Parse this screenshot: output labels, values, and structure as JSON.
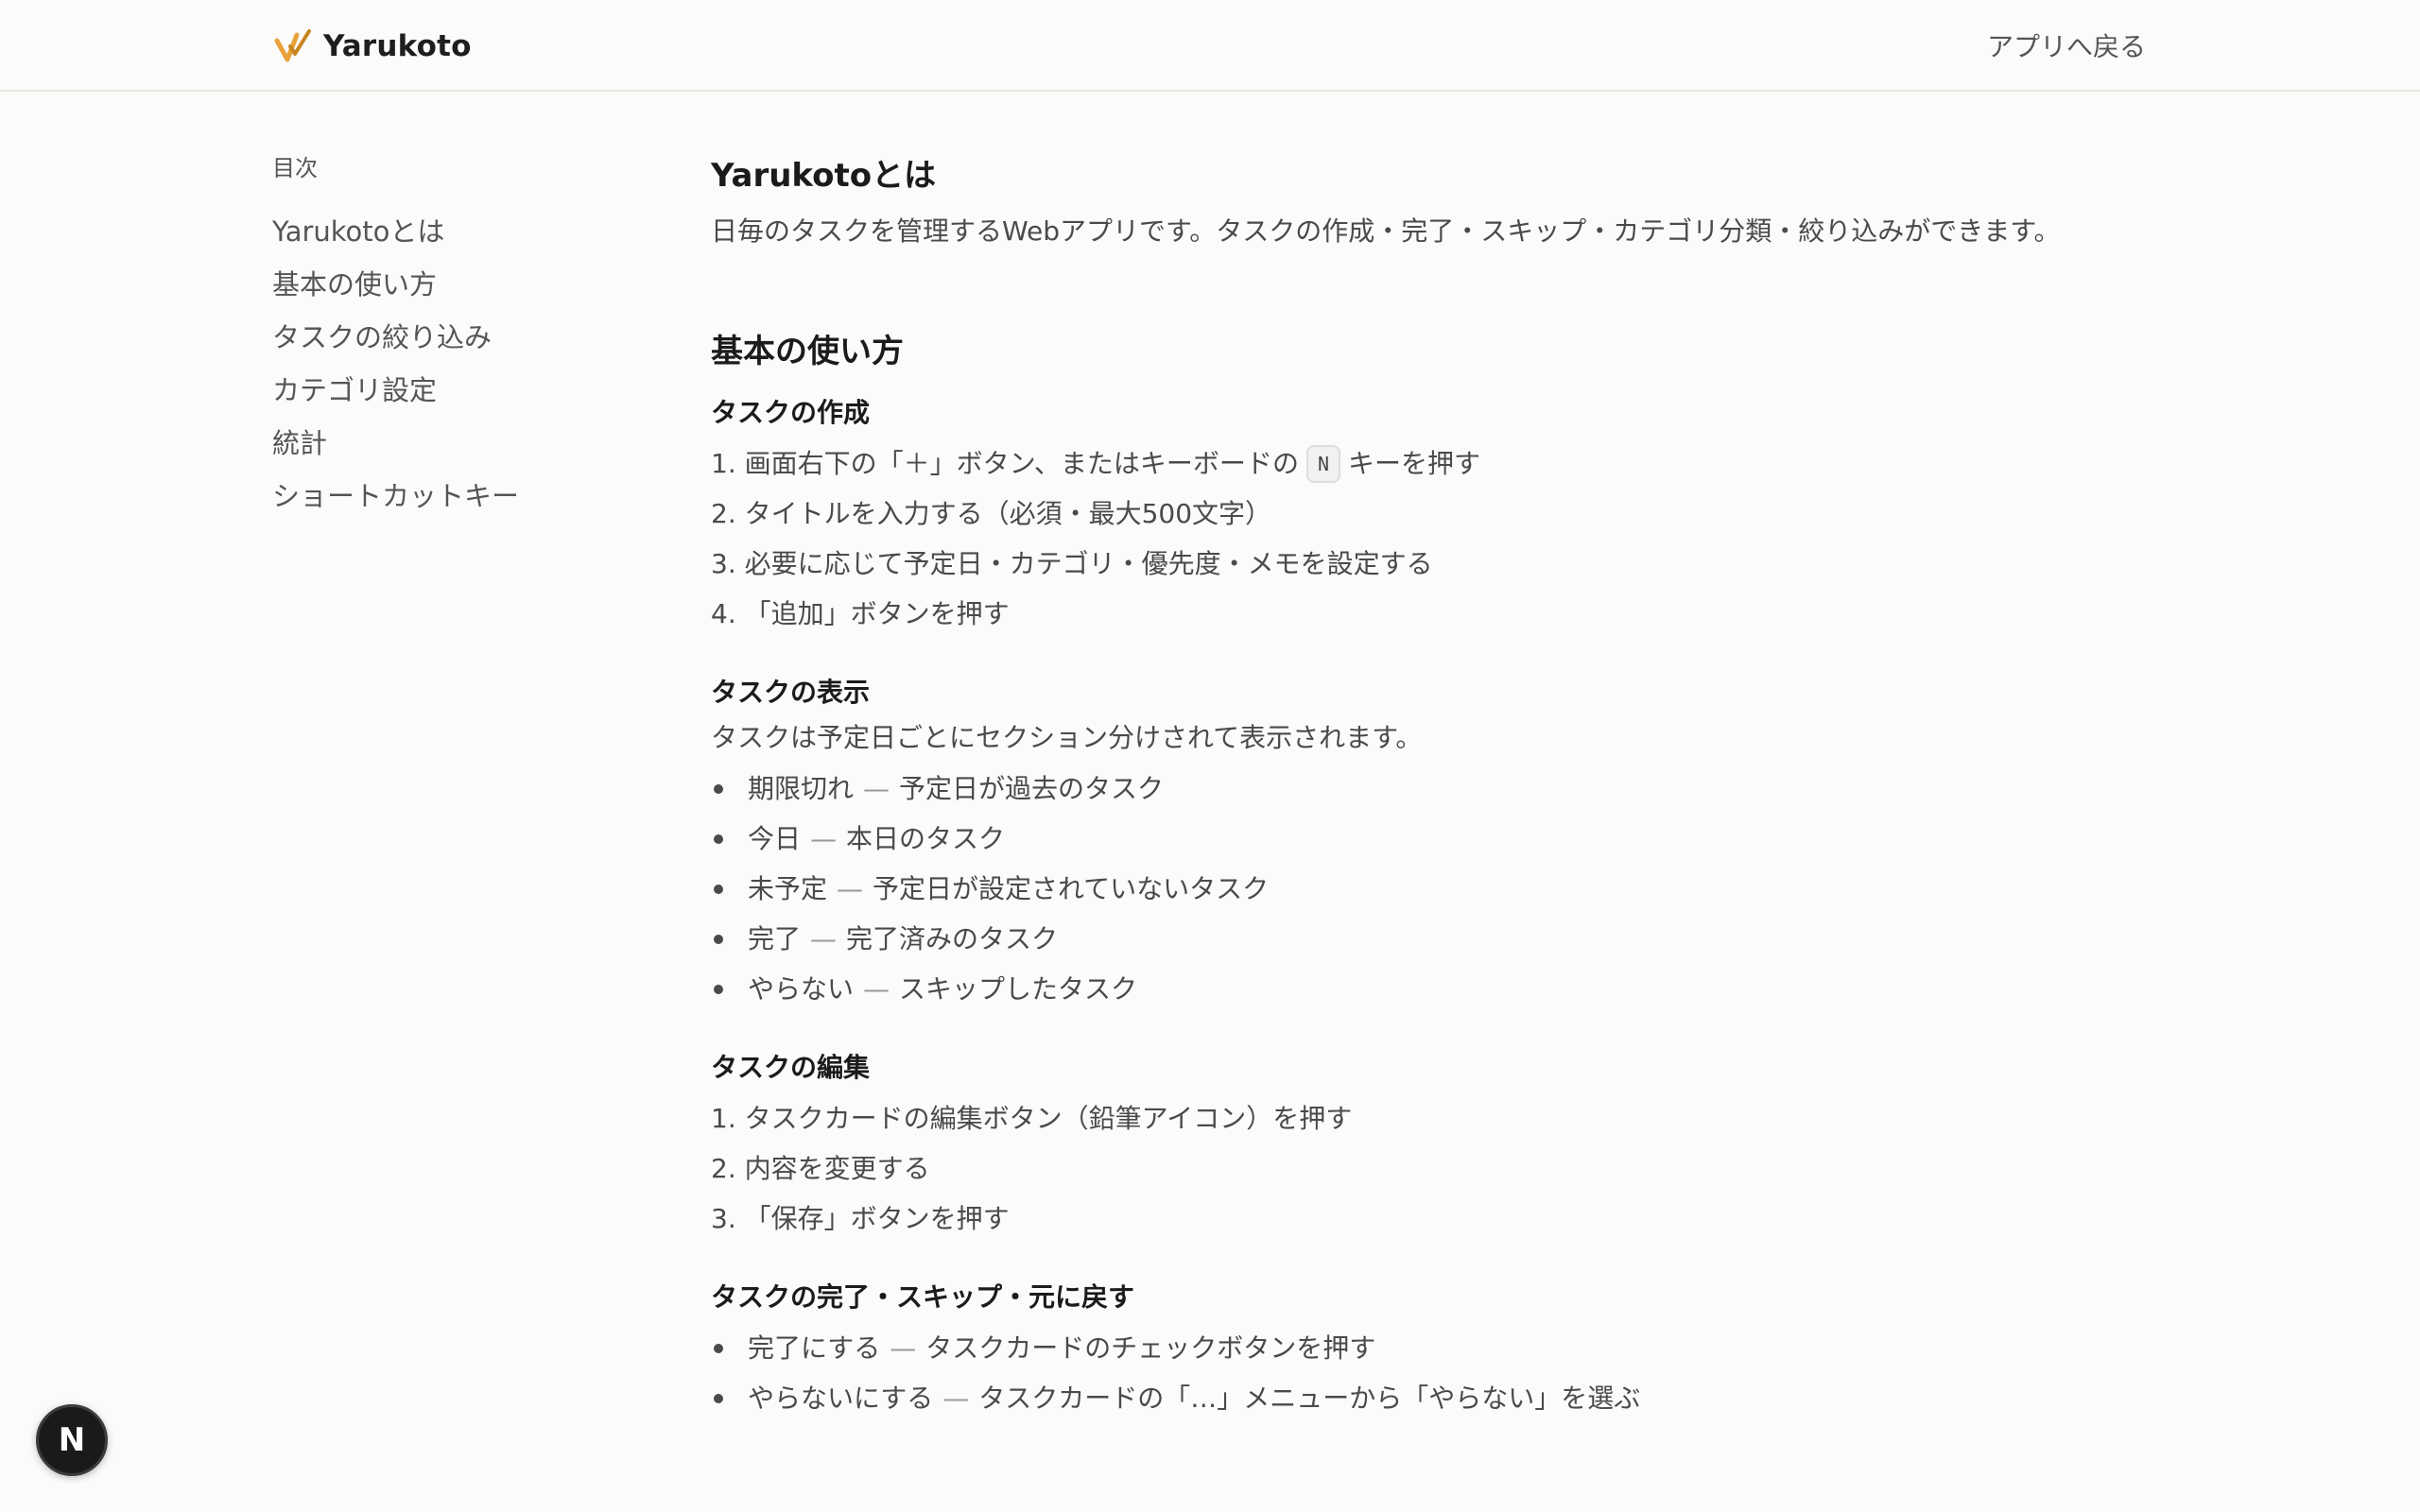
{
  "header": {
    "app_name": "Yarukoto",
    "back_link": "アプリへ戻る"
  },
  "toc": {
    "heading": "目次",
    "items": [
      {
        "label": "Yarukotoとは"
      },
      {
        "label": "基本の使い方"
      },
      {
        "label": "タスクの絞り込み"
      },
      {
        "label": "カテゴリ設定"
      },
      {
        "label": "統計"
      },
      {
        "label": "ショートカットキー"
      }
    ]
  },
  "intro": {
    "title": "Yarukotoとは",
    "body": "日毎のタスクを管理するWebアプリです。タスクの作成・完了・スキップ・カテゴリ分類・絞り込みができます。"
  },
  "basics": {
    "title": "基本の使い方",
    "create": {
      "title": "タスクの作成",
      "step1_before": "1. 画面右下の「＋」ボタン、またはキーボードの",
      "step1_key": "N",
      "step1_after": "キーを押す",
      "step2": "2. タイトルを入力する（必須・最大500文字）",
      "step3": "3. 必要に応じて予定日・カテゴリ・優先度・メモを設定する",
      "step4": "4. 「追加」ボタンを押す"
    },
    "display": {
      "title": "タスクの表示",
      "body": "タスクは予定日ごとにセクション分けされて表示されます。",
      "dash": "—",
      "items": [
        {
          "term": "期限切れ",
          "desc": "予定日が過去のタスク"
        },
        {
          "term": "今日",
          "desc": "本日のタスク"
        },
        {
          "term": "未予定",
          "desc": "予定日が設定されていないタスク"
        },
        {
          "term": "完了",
          "desc": "完了済みのタスク"
        },
        {
          "term": "やらない",
          "desc": "スキップしたタスク"
        }
      ]
    },
    "edit": {
      "title": "タスクの編集",
      "step1": "1. タスクカードの編集ボタン（鉛筆アイコン）を押す",
      "step2": "2. 内容を変更する",
      "step3": "3. 「保存」ボタンを押す"
    },
    "complete": {
      "title": "タスクの完了・スキップ・元に戻す",
      "items": [
        {
          "term": "完了にする",
          "desc": "タスクカードのチェックボタンを押す"
        },
        {
          "term": "やらないにする",
          "desc": "タスクカードの「…」メニューから「やらない」を選ぶ"
        }
      ]
    }
  },
  "dev_badge": {
    "letter": "N"
  },
  "colors": {
    "accent": "#e8a33a",
    "background": "#fbfbfa"
  }
}
